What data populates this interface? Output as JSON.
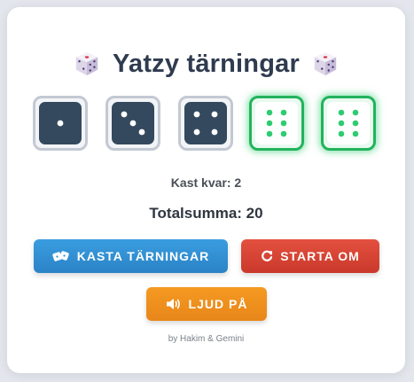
{
  "title": {
    "text": "Yatzy tärningar",
    "left_icon": "game-die-icon",
    "right_icon": "game-die-icon"
  },
  "dice": [
    {
      "value": 1,
      "held": false
    },
    {
      "value": 3,
      "held": false
    },
    {
      "value": 4,
      "held": false
    },
    {
      "value": 6,
      "held": true
    },
    {
      "value": 6,
      "held": true
    }
  ],
  "info": {
    "rolls_left": "Kast kvar: 2",
    "total": "Totalsumma: 20"
  },
  "buttons": {
    "roll": {
      "label": "KASTA TÄRNINGAR",
      "icon": "dice-icon",
      "color": "#3498db"
    },
    "reset": {
      "label": "STARTA OM",
      "icon": "redo-icon",
      "color": "#e74c3c"
    },
    "sound": {
      "label": "LJUD PÅ",
      "icon": "volume-icon",
      "color": "#f39c12"
    }
  },
  "credit": "by Hakim & Gemini",
  "colors": {
    "die_normal": "#34495e",
    "die_held_border": "#2ecc71",
    "pip_normal": "#ffffff",
    "pip_held": "#2ecc71",
    "title": "#2f3b4f"
  }
}
